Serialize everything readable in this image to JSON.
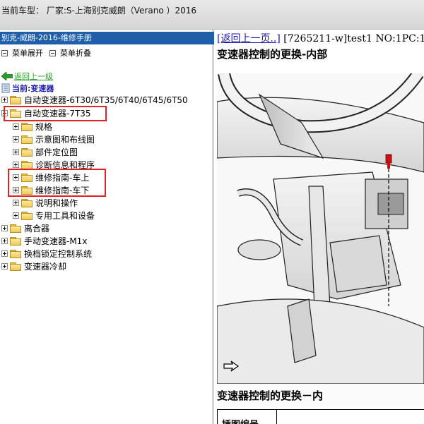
{
  "header": {
    "vehicle_text": "当前车型： 厂家:S-上海别克威朗（Verano ）2016"
  },
  "left_panel": {
    "title": "别克-威朗-2016-维修手册",
    "expand_label": "菜单展开",
    "collapse_label": "菜单折叠",
    "back_label": "返回上一级",
    "current_label": "当前:变速器",
    "tree": [
      {
        "label": "自动变速器-6T30/6T35/6T40/6T45/6T50"
      },
      {
        "label": "自动变速器-7T35"
      },
      {
        "label": "规格"
      },
      {
        "label": "示意图和布线图"
      },
      {
        "label": "部件定位图"
      },
      {
        "label": "诊断信息和程序"
      },
      {
        "label": "维修指南-车上"
      },
      {
        "label": "维修指南-车下"
      },
      {
        "label": "说明和操作"
      },
      {
        "label": "专用工具和设备"
      },
      {
        "label": "离合器"
      },
      {
        "label": "手动变速器-M1x"
      },
      {
        "label": "换档锁定控制系统"
      },
      {
        "label": "变速器冷却"
      }
    ]
  },
  "content": {
    "back_link": "[返回上一页..]",
    "doc_info": "[7265211-w]test1 NO:1PC:1",
    "heading": "变速器控制的更换-内部",
    "subheading": "变速器控制的更换－内",
    "table_header": "插图编号"
  },
  "colors": {
    "title_bar": "#1f5fa9",
    "highlight_box": "#e02222",
    "link": "#1a1aa8",
    "back_arrow": "#2e9a2e"
  }
}
